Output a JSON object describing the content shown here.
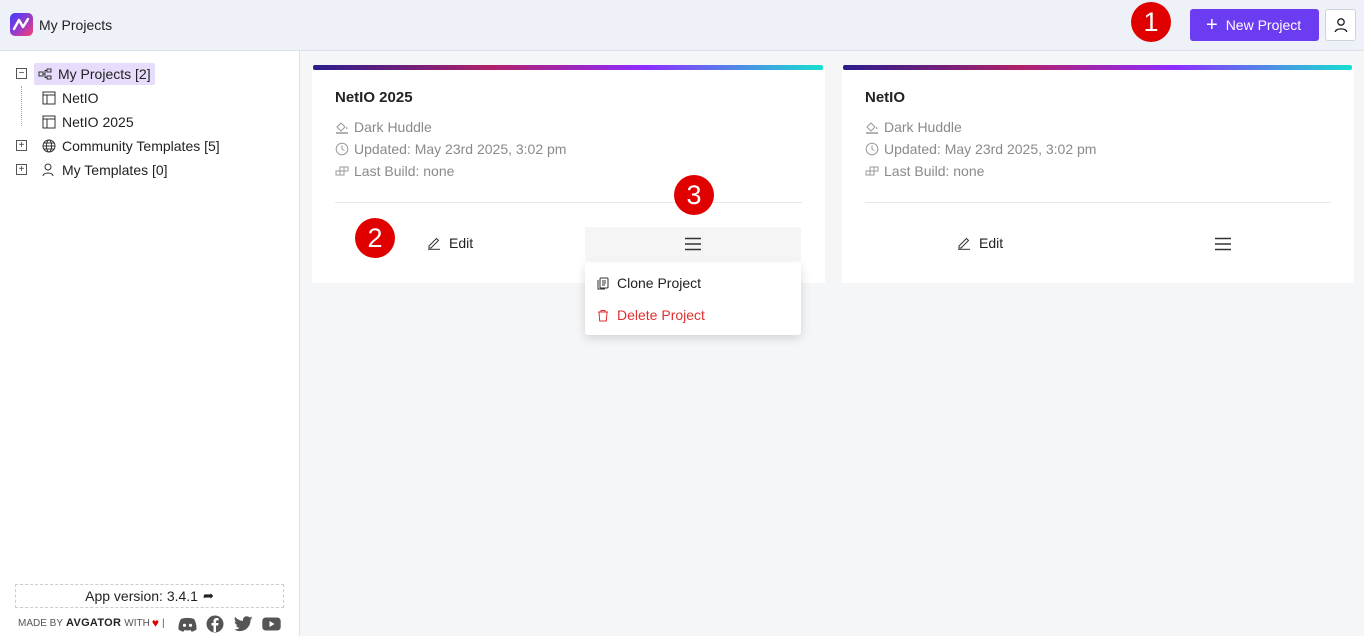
{
  "header": {
    "title": "My Projects",
    "new_project_label": "New Project"
  },
  "badges": [
    "1",
    "2",
    "3"
  ],
  "tree": {
    "root_label": "My Projects [2]",
    "children": [
      "NetIO",
      "NetIO 2025"
    ],
    "community_label": "Community Templates [5]",
    "my_templates_label": "My Templates [0]"
  },
  "footer": {
    "version_label": "App version: 3.4.1",
    "made_by_prefix": "MADE BY",
    "brand": "AVGATOR",
    "made_with": "WITH",
    "separator": "|"
  },
  "cards": [
    {
      "title": "NetIO 2025",
      "theme": "Dark Huddle",
      "updated": "Updated: May 23rd 2025, 3:02 pm",
      "last_build": "Last Build: none",
      "edit_label": "Edit"
    },
    {
      "title": "NetIO",
      "theme": "Dark Huddle",
      "updated": "Updated: May 23rd 2025, 3:02 pm",
      "last_build": "Last Build: none",
      "edit_label": "Edit"
    }
  ],
  "dropdown": {
    "clone_label": "Clone Project",
    "delete_label": "Delete Project"
  },
  "colors": {
    "accent": "#6c3cf2",
    "badge": "#e00000",
    "danger": "#e03030",
    "selected_bg": "#e7dcfb"
  }
}
